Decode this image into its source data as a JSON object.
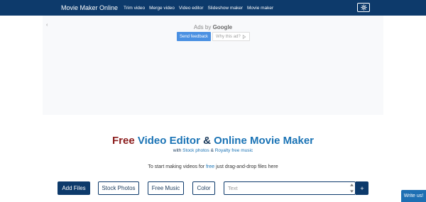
{
  "nav": {
    "brand": "Movie Maker Online",
    "links": [
      "Trim video",
      "Merge video",
      "Video editor",
      "Slideshow maker",
      "Movie maker"
    ],
    "settings_icon": "gear-icon"
  },
  "ad": {
    "back_arrow": "‹",
    "ads_by_prefix": "Ads by",
    "ads_by_brand": "Google",
    "send_feedback": "Send feedback",
    "why_this_ad": "Why this ad?"
  },
  "hero": {
    "title_free": "Free",
    "title_video_editor": "Video Editor",
    "title_amp": "&",
    "title_online_movie_maker": "Online Movie Maker",
    "sub_with": "with",
    "sub_stock": "Stock photos",
    "sub_amp": "&",
    "sub_royalty": "Royalty free music",
    "instr_before": "To start making videos for",
    "instr_free": "free",
    "instr_after": "just drag-and-drop files here"
  },
  "toolbar": {
    "add_files": "Add Files",
    "stock_photos": "Stock Photos",
    "free_music": "Free Music",
    "color": "Color",
    "text_placeholder": "Text",
    "add_text": "+"
  },
  "write_us": "Write us!",
  "colors": {
    "navbar": "#0d3a6b",
    "accent_blue": "#1a73b5",
    "free_red": "#8b1c1c"
  }
}
